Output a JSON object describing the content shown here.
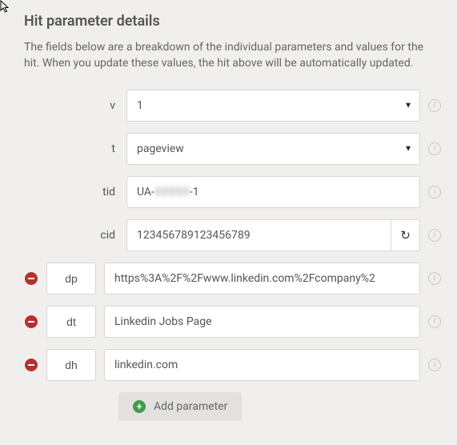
{
  "title": "Hit parameter details",
  "description": "The fields below are a breakdown of the individual parameters and values for the hit. When you update these values, the hit above will be automatically updated.",
  "fixed": {
    "v": {
      "label": "v",
      "value": "1"
    },
    "t": {
      "label": "t",
      "value": "pageview"
    },
    "tid": {
      "label": "tid",
      "value_prefix": "UA-",
      "value_redacted": "XXXXX",
      "value_suffix": "-1"
    },
    "cid": {
      "label": "cid",
      "value": "123456789123456789"
    }
  },
  "params": [
    {
      "key": "dp",
      "value": "https%3A%2F%2Fwww.linkedin.com%2Fcompany%2"
    },
    {
      "key": "dt",
      "value": "Linkedin Jobs Page"
    },
    {
      "key": "dh",
      "value": "linkedin.com"
    }
  ],
  "addLabel": "Add parameter"
}
